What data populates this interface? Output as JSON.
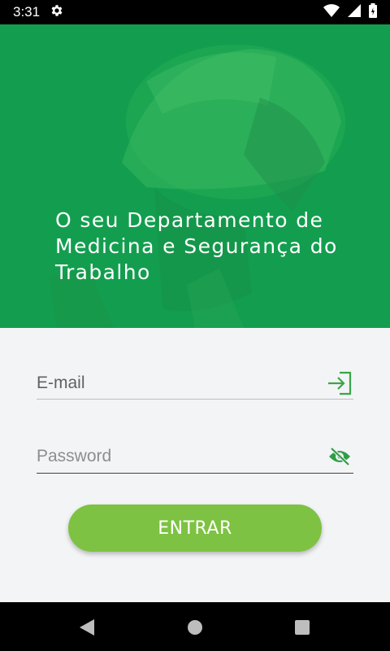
{
  "status_bar": {
    "time": "3:31",
    "icons": [
      "gear-icon",
      "wifi-icon",
      "signal-icon",
      "battery-charging-icon"
    ]
  },
  "hero": {
    "headline": "O seu Departamento de Medicina e Segurança do Trabalho",
    "background_color": "#139e4f"
  },
  "form": {
    "email_placeholder": "E-mail",
    "email_icon": "login-arrow-icon",
    "password_placeholder": "Password",
    "password_icon": "eye-off-icon",
    "submit_label": "ENTRAR",
    "accent_color": "#7dc242",
    "icon_color": "#3aa64a"
  },
  "nav_bar": {
    "buttons": [
      "back-icon",
      "home-icon",
      "recents-icon"
    ]
  }
}
